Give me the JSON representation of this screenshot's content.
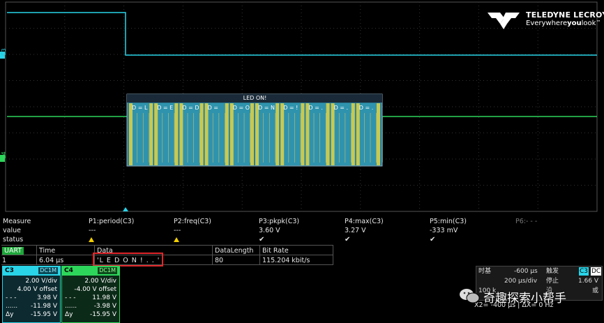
{
  "brand": {
    "name": "TELEDYNE LECROY",
    "tagline_pre": "Everywhere",
    "tagline_bold": "you",
    "tagline_post": "look",
    "tm": "™"
  },
  "channel_markers": {
    "c3": "C3",
    "c4": "C4"
  },
  "decode": {
    "title": "LED ON!",
    "segments": [
      "D = L",
      "D = E",
      "D = D",
      "D = ",
      "D = O",
      "D = N",
      "D = !",
      "D = .",
      "D = .",
      "D = ."
    ]
  },
  "measure": {
    "headers": [
      "Measure",
      "P1:period(C3)",
      "P2:freq(C3)",
      "P3:pkpk(C3)",
      "P4:max(C3)",
      "P5:min(C3)",
      "P6:- - -"
    ],
    "value_label": "value",
    "values": [
      "---",
      "---",
      "3.60 V",
      "3.27 V",
      "-333 mV"
    ],
    "status_label": "status"
  },
  "uart": {
    "tag": "UART",
    "headers": {
      "time": "Time",
      "data": "Data",
      "length": "DataLength",
      "rate": "Bit Rate"
    },
    "row": {
      "index": "1",
      "time": "6.04 µs",
      "data": "'L E D  O N ! . . '",
      "length": "80",
      "rate": "115.204 kbit/s"
    }
  },
  "channels": [
    {
      "name": "C3",
      "coupling": "DC1M",
      "vdiv": "2.00 V/div",
      "offset": "4.00 V offset",
      "l1": "3.98 V",
      "l2": "-11.98 V",
      "dy_label": "Δy",
      "dy": "-15.95 V",
      "color": "#29d4e8"
    },
    {
      "name": "C4",
      "coupling": "DC1M",
      "vdiv": "2.00 V/div",
      "offset": "-4.00 V offset",
      "l1": "11.98 V",
      "l2": "-3.98 V",
      "dy_label": "Δy",
      "dy": "-15.95 V",
      "color": "#2dd65a"
    }
  ],
  "timebase": {
    "label": "时基",
    "delay": "-600 µs",
    "tdiv": "200 µs/div",
    "left_partial": "100 k",
    "trigger_label": "触发",
    "trig_badge1": "C3",
    "trig_badge2": "DC",
    "trig_stop": "停止",
    "trig_level": "1.66 V",
    "trig_mode": "沿",
    "trig_slope": "或"
  },
  "cursor": {
    "line2": "X2= -400 µs | ΔX= 0 Hz"
  },
  "watermark": "奇趣探索小帮手",
  "colors": {
    "c3": "#29d4e8",
    "c4": "#2dd65a",
    "decode_fill": "#2e8fa8",
    "decode_edge": "#e8d84a",
    "grid": "#3a3a3a"
  }
}
